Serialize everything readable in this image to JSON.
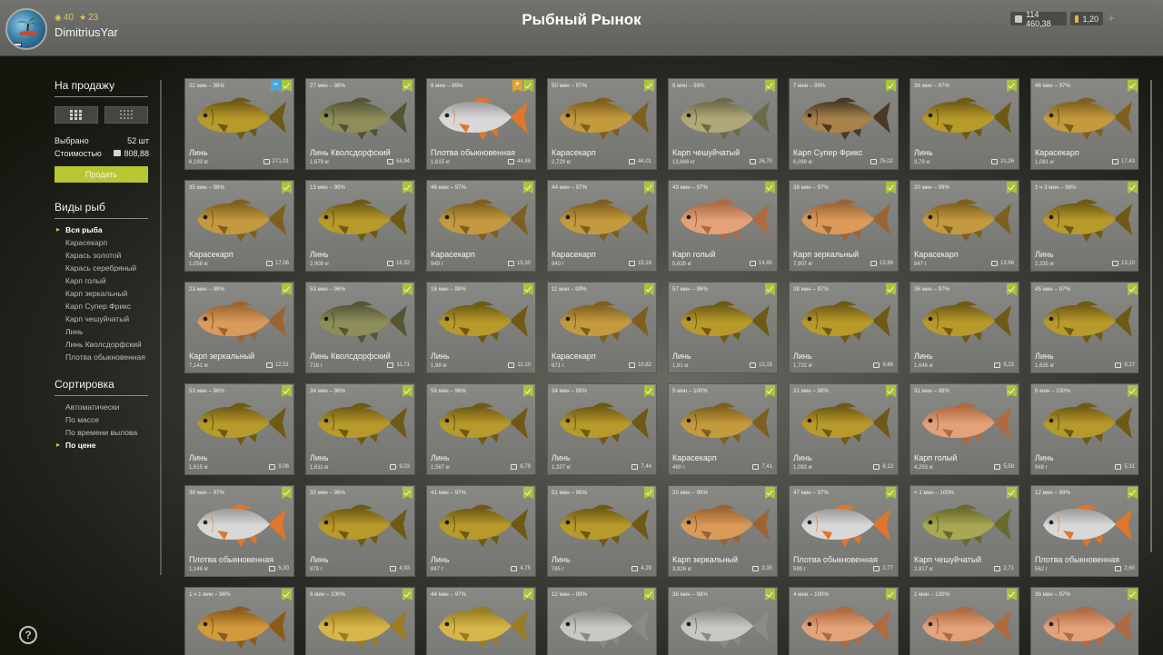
{
  "player": {
    "name": "DimitriusYar",
    "stat_a": "40",
    "stat_b": "23"
  },
  "title": "Рыбный Рынок",
  "currency": {
    "silver": "114 460,38",
    "gold": "1,20",
    "silver_color": "#c9c9c4",
    "gold_color": "#e0b63a"
  },
  "sidebar": {
    "for_sale_title": "На продажу",
    "selected_label": "Выбрано",
    "selected_value": "52 шт",
    "cost_label": "Стоимостью",
    "cost_value": "808,88",
    "sell_label": "Продать",
    "species_title": "Виды рыб",
    "species": [
      {
        "label": "Вся рыба",
        "active": true
      },
      {
        "label": "Карасекарп",
        "active": false
      },
      {
        "label": "Карась золотой",
        "active": false
      },
      {
        "label": "Карась серебряный",
        "active": false
      },
      {
        "label": "Карп голый",
        "active": false
      },
      {
        "label": "Карп зеркальный",
        "active": false
      },
      {
        "label": "Карп Супер Фрикс",
        "active": false
      },
      {
        "label": "Карп чешуйчатый",
        "active": false
      },
      {
        "label": "Линь",
        "active": false
      },
      {
        "label": "Линь Кволсдорфский",
        "active": false
      },
      {
        "label": "Плотва обыкновенная",
        "active": false
      }
    ],
    "sort_title": "Сортировка",
    "sort_options": [
      {
        "label": "Автоматически",
        "active": false
      },
      {
        "label": "По массе",
        "active": false
      },
      {
        "label": "По времени вылова",
        "active": false
      },
      {
        "label": "По цене",
        "active": true
      }
    ],
    "help": "?"
  },
  "cards": [
    {
      "meta": "22 мин – 98%",
      "name": "Линь",
      "weight": "6,193 кг",
      "price": "271,01",
      "fish": "tench",
      "badge": "blue"
    },
    {
      "meta": "27 мин – 98%",
      "name": "Линь Кволсдорфский",
      "weight": "1,679 кг",
      "price": "54,94",
      "fish": "tench_green"
    },
    {
      "meta": "9 мин – 99%",
      "name": "Плотва обыкновенная",
      "weight": "1,615 кг",
      "price": "44,86",
      "fish": "roach",
      "badge": "gold"
    },
    {
      "meta": "50 мин – 97%",
      "name": "Карасекарп",
      "weight": "2,729 кг",
      "price": "44,01",
      "fish": "crucian"
    },
    {
      "meta": "8 мин – 99%",
      "name": "Карп чешуйчатый",
      "weight": "13,846 кг",
      "price": "26,70",
      "fish": "carp_scaly"
    },
    {
      "meta": "7 мин – 99%",
      "name": "Карп Супер Фрикс",
      "weight": "6,099 кг",
      "price": "25,02",
      "fish": "carp_dark"
    },
    {
      "meta": "36 мин – 97%",
      "name": "Линь",
      "weight": "3,79 кг",
      "price": "21,26",
      "fish": "tench"
    },
    {
      "meta": "46 мин – 97%",
      "name": "Карасекарп",
      "weight": "1,081 кг",
      "price": "17,43",
      "fish": "crucian"
    },
    {
      "meta": "35 мин – 98%",
      "name": "Карасекарп",
      "weight": "1,058 кг",
      "price": "17,06",
      "fish": "crucian"
    },
    {
      "meta": "13 мин – 99%",
      "name": "Линь",
      "weight": "2,909 кг",
      "price": "16,32",
      "fish": "tench"
    },
    {
      "meta": "46 мин – 97%",
      "name": "Карасекарп",
      "weight": "949 г",
      "price": "15,30",
      "fish": "crucian"
    },
    {
      "meta": "44 мин – 97%",
      "name": "Карасекарп",
      "weight": "940 г",
      "price": "15,16",
      "fish": "crucian"
    },
    {
      "meta": "43 мин – 97%",
      "name": "Карп голый",
      "weight": "5,628 кг",
      "price": "14,80",
      "fish": "carp_naked"
    },
    {
      "meta": "38 мин – 97%",
      "name": "Карп зеркальный",
      "weight": "7,907 кг",
      "price": "13,86",
      "fish": "carp_mirror"
    },
    {
      "meta": "20 мин – 99%",
      "name": "Карасекарп",
      "weight": "847 г",
      "price": "13,66",
      "fish": "crucian"
    },
    {
      "meta": "1 ч 3 мин – 96%",
      "name": "Линь",
      "weight": "2,335 кг",
      "price": "13,10",
      "fish": "tench"
    },
    {
      "meta": "23 мин – 98%",
      "name": "Карп зеркальный",
      "weight": "7,141 кг",
      "price": "12,51",
      "fish": "carp_mirror"
    },
    {
      "meta": "53 мин – 96%",
      "name": "Линь Кволсдорфский",
      "weight": "716 г",
      "price": "11,71",
      "fish": "tench_green"
    },
    {
      "meta": "16 мин – 99%",
      "name": "Линь",
      "weight": "1,98 кг",
      "price": "11,10",
      "fish": "tench"
    },
    {
      "meta": "11 мин – 99%",
      "name": "Карасекарп",
      "weight": "671 г",
      "price": "10,82",
      "fish": "crucian"
    },
    {
      "meta": "57 мин – 96%",
      "name": "Линь",
      "weight": "1,81 кг",
      "price": "10,15",
      "fish": "tench"
    },
    {
      "meta": "38 мин – 97%",
      "name": "Линь",
      "weight": "1,722 кг",
      "price": "9,66",
      "fish": "tench"
    },
    {
      "meta": "36 мин – 97%",
      "name": "Линь",
      "weight": "1,646 кг",
      "price": "9,23",
      "fish": "tench"
    },
    {
      "meta": "45 мин – 97%",
      "name": "Линь",
      "weight": "1,635 кг",
      "price": "9,17",
      "fish": "tench"
    },
    {
      "meta": "53 мин – 96%",
      "name": "Линь",
      "weight": "1,615 кг",
      "price": "9,06",
      "fish": "tench"
    },
    {
      "meta": "34 мин – 98%",
      "name": "Линь",
      "weight": "1,611 кг",
      "price": "9,03",
      "fish": "tench"
    },
    {
      "meta": "56 мин – 96%",
      "name": "Линь",
      "weight": "1,567 кг",
      "price": "8,79",
      "fish": "tench"
    },
    {
      "meta": "34 мин – 98%",
      "name": "Линь",
      "weight": "1,327 кг",
      "price": "7,44",
      "fish": "tench"
    },
    {
      "meta": "5 мин – 100%",
      "name": "Карасекарп",
      "weight": "460 г",
      "price": "7,41",
      "fish": "crucian"
    },
    {
      "meta": "31 мин – 98%",
      "name": "Линь",
      "weight": "1,093 кг",
      "price": "6,13",
      "fish": "tench"
    },
    {
      "meta": "31 мин – 98%",
      "name": "Карп голый",
      "weight": "4,253 кг",
      "price": "5,59",
      "fish": "carp_naked"
    },
    {
      "meta": "6 мин – 100%",
      "name": "Линь",
      "weight": "948 г",
      "price": "5,31",
      "fish": "tench"
    },
    {
      "meta": "38 мин – 97%",
      "name": "Плотва обыкновенная",
      "weight": "1,146 кг",
      "price": "5,30",
      "fish": "roach"
    },
    {
      "meta": "35 мин – 98%",
      "name": "Линь",
      "weight": "879 г",
      "price": "4,93",
      "fish": "tench"
    },
    {
      "meta": "41 мин – 97%",
      "name": "Линь",
      "weight": "847 г",
      "price": "4,75",
      "fish": "tench"
    },
    {
      "meta": "51 мин – 96%",
      "name": "Линь",
      "weight": "765 г",
      "price": "4,29",
      "fish": "tench"
    },
    {
      "meta": "20 мин – 99%",
      "name": "Карп зеркальный",
      "weight": "3,826 кг",
      "price": "3,35",
      "fish": "carp_mirror"
    },
    {
      "meta": "47 мин – 97%",
      "name": "Плотва обыкновенная",
      "weight": "599 г",
      "price": "2,77",
      "fish": "roach"
    },
    {
      "meta": "< 1 мин – 100%",
      "name": "Карп чешуйчатый",
      "weight": "2,817 кг",
      "price": "2,71",
      "fish": "carp_scaly_green"
    },
    {
      "meta": "12 мин – 99%",
      "name": "Плотва обыкновенная",
      "weight": "562 г",
      "price": "2,60",
      "fish": "roach"
    },
    {
      "meta": "1 ч 1 мин – 96%",
      "name": "",
      "weight": "",
      "price": "",
      "fish": "carp_gold"
    },
    {
      "meta": "6 мин – 100%",
      "name": "",
      "weight": "",
      "price": "",
      "fish": "tench_yellow"
    },
    {
      "meta": "44 мин – 97%",
      "name": "",
      "weight": "",
      "price": "",
      "fish": "tench_yellow"
    },
    {
      "meta": "12 мин – 99%",
      "name": "",
      "weight": "",
      "price": "",
      "fish": "silver_crucian"
    },
    {
      "meta": "36 мин – 98%",
      "name": "",
      "weight": "",
      "price": "",
      "fish": "silver_crucian"
    },
    {
      "meta": "4 мин – 100%",
      "name": "",
      "weight": "",
      "price": "",
      "fish": "carp_naked"
    },
    {
      "meta": "1 мин – 100%",
      "name": "",
      "weight": "",
      "price": "",
      "fish": "carp_naked"
    },
    {
      "meta": "36 мин – 97%",
      "name": "",
      "weight": "",
      "price": "",
      "fish": "carp_naked"
    }
  ],
  "fish_colors": {
    "tench": [
      "#b89a2a",
      "#6e5a14",
      "#3d3008"
    ],
    "tench_green": [
      "#8e8e5a",
      "#555535",
      "#2e2e1c"
    ],
    "tench_yellow": [
      "#d6b64a",
      "#9a7c22",
      "#5a460e"
    ],
    "crucian": [
      "#c49a3e",
      "#7f5f1e",
      "#4a3510"
    ],
    "roach": [
      "#d8d8d8",
      "#9a9a9a",
      "#e0762a"
    ],
    "carp_scaly": [
      "#b0a878",
      "#6e6a48",
      "#3f3c26"
    ],
    "carp_scaly_green": [
      "#a8a852",
      "#6a6a2c",
      "#3c3c18"
    ],
    "carp_dark": [
      "#a8824a",
      "#4a3a24",
      "#2a2014"
    ],
    "carp_naked": [
      "#e3a27a",
      "#b06a40",
      "#6e3a1e"
    ],
    "carp_mirror": [
      "#d99a5a",
      "#9c6432",
      "#5e3818"
    ],
    "carp_gold": [
      "#d29a3c",
      "#8e5a1a",
      "#4a2e0c"
    ],
    "silver_crucian": [
      "#c8c8c4",
      "#8a8a86",
      "#50504c"
    ]
  }
}
